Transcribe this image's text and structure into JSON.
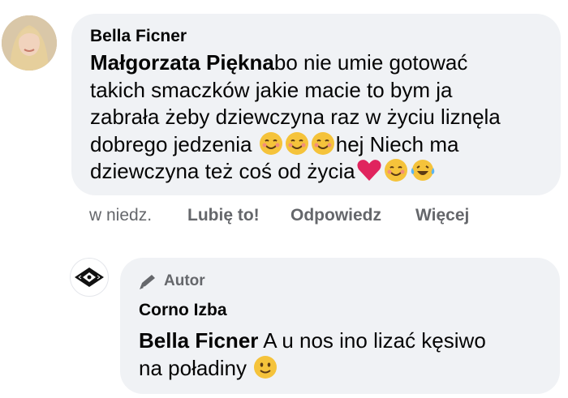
{
  "comment": {
    "author": "Bella Ficner",
    "mention": "Małgorzata Piękna",
    "lines": [
      "bo nie umie gotować",
      "takich smaczków jakie macie to bym ja",
      "zabrała żeby dziewczyna raz w życiu liznęla",
      "dobrego jedzenia",
      "hej Niech ma",
      "dziewczyna też coś od życia"
    ],
    "timestamp": "w niedz.",
    "like_label": "Lubię to!",
    "reply_label": "Odpowiedz",
    "more_label": "Więcej"
  },
  "reply": {
    "badge_label": "Autor",
    "author": "Corno Izba",
    "mention": "Bella Ficner",
    "text_line1": " A u nos ino lizać kęsiwo",
    "text_line2": "na poładiny"
  },
  "colors": {
    "bubble": "#f0f2f5",
    "text": "#050505",
    "secondary": "#65676b",
    "heart": "#e0245e",
    "emoji": "#f5c33b"
  },
  "icons": [
    "smiling-blush-emoji-icon",
    "red-heart-icon",
    "tears-of-joy-emoji-icon",
    "slight-smile-emoji-icon",
    "pencil-icon"
  ]
}
